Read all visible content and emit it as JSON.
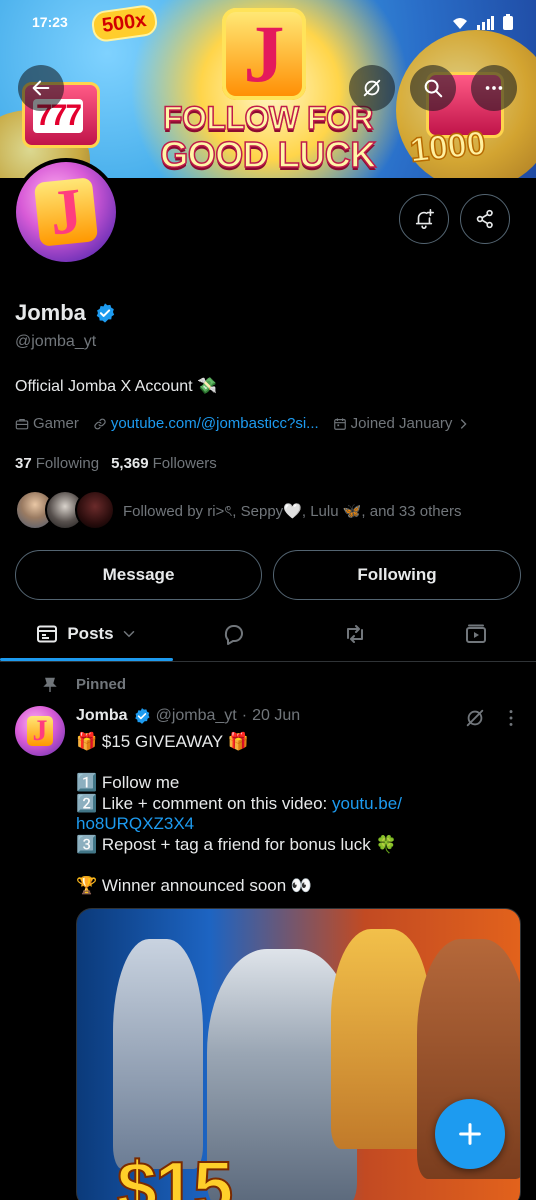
{
  "status_bar": {
    "time": "17:23"
  },
  "banner": {
    "badge": "500x",
    "logo_letter": "J",
    "slogan_line1": "FOLLOW FOR",
    "slogan_line2": "GOOD LUCK",
    "reels": "777",
    "amount": "1000"
  },
  "profile": {
    "avatar_letter": "J",
    "name": "Jomba",
    "handle": "@jomba_yt",
    "bio": "Official Jomba X Account 💸",
    "category": "Gamer",
    "link": "youtube.com/@jombasticc?si...",
    "joined": "Joined January",
    "following_count": "37",
    "following_label": "Following",
    "followers_count": "5,369",
    "followers_label": "Followers",
    "followed_by": "Followed by ri>ৎ, Seppy🤍, Lulu 🦋, and 33 others"
  },
  "actions": {
    "message": "Message",
    "following": "Following"
  },
  "tabs": {
    "posts": "Posts"
  },
  "post": {
    "pinned_label": "Pinned",
    "avatar_letter": "J",
    "author": "Jomba",
    "handle": "@jomba_yt",
    "separator": "·",
    "date": "20 Jun",
    "line1": "🎁 $15 GIVEAWAY 🎁",
    "line2": "1️⃣ Follow me",
    "line3_text": "2️⃣ Like + comment on this video: ",
    "line3_link": "youtu.be/",
    "line4_link": "ho8URQXZ3X4",
    "line5": "3️⃣ Repost + tag a friend for bonus luck 🍀",
    "line6": "🏆 Winner announced soon 👀",
    "media_text": "$15"
  },
  "colors": {
    "accent": "#1d9bf0",
    "background": "#000000",
    "muted": "#71767b",
    "border": "#536471"
  }
}
